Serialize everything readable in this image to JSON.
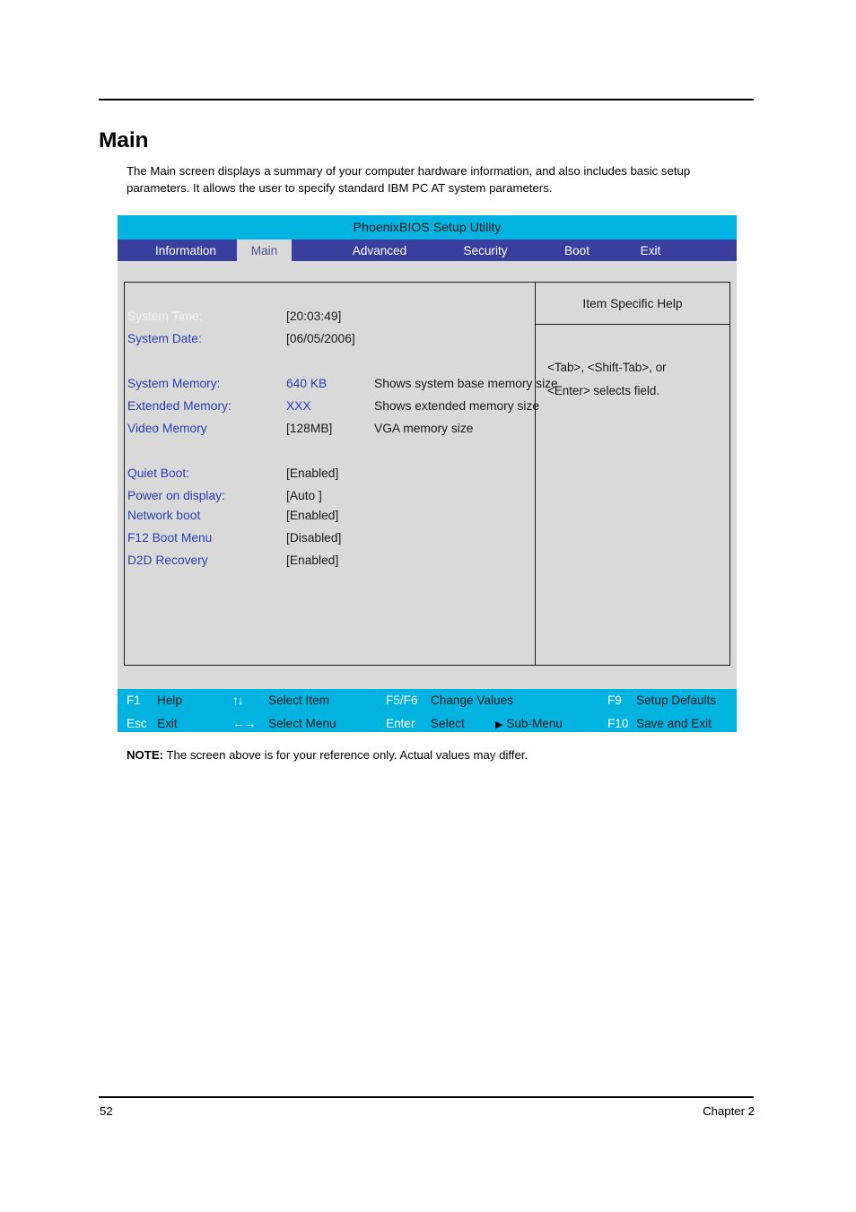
{
  "document": {
    "heading": "Main",
    "intro": "The Main screen displays a summary of your computer hardware information, and also includes basic setup parameters. It allows the user to specify standard IBM PC AT system parameters.",
    "note_label": "NOTE:",
    "note_text": " The screen above is for your reference only. Actual values may differ.",
    "page_number": "52",
    "chapter": "Chapter 2"
  },
  "bios": {
    "title": "PhoenixBIOS Setup Utility",
    "colors": {
      "title_bar": "#00b3e0",
      "tab_bar": "#3a3f9e",
      "active_tab_bg": "#d9d9d9",
      "active_tab_text": "#4a5296",
      "screen_bg": "#d9d9d9",
      "label_blue": "#2d3fb0",
      "footer_bar": "#00b3e0"
    },
    "tabs": [
      {
        "label": "Information",
        "active": false
      },
      {
        "label": "Main",
        "active": true
      },
      {
        "label": "Advanced",
        "active": false
      },
      {
        "label": "Security",
        "active": false
      },
      {
        "label": "Boot",
        "active": false
      },
      {
        "label": "Exit",
        "active": false
      }
    ],
    "settings": [
      {
        "label": "System Time:",
        "value": "[20:03:49]",
        "desc": ""
      },
      {
        "label": "System Date:",
        "value": "[06/05/2006]",
        "desc": ""
      },
      {
        "label": "System Memory:",
        "value": "640 KB",
        "desc": "Shows system base memory size"
      },
      {
        "label": "Extended Memory:",
        "value": "XXX",
        "desc": "Shows extended memory size"
      },
      {
        "label": "Video Memory",
        "value": "[128MB]",
        "desc": "VGA memory size"
      },
      {
        "label": "Quiet Boot:",
        "value": "[Enabled]",
        "desc": ""
      },
      {
        "label": "Power on display:",
        "value": "[Auto ]",
        "desc": ""
      },
      {
        "label": "Network boot",
        "value": "[Enabled]",
        "desc": ""
      },
      {
        "label": "F12 Boot Menu",
        "value": "[Disabled]",
        "desc": ""
      },
      {
        "label": "D2D Recovery",
        "value": "[Enabled]",
        "desc": ""
      }
    ],
    "help": {
      "title": "Item Specific Help",
      "line1": "<Tab>, <Shift-Tab>, or",
      "line2": "<Enter> selects field."
    },
    "footer": {
      "f1_key": "F1",
      "f1_label": "Help",
      "esc_key": "Esc",
      "esc_label": "Exit",
      "updown_sym": "↑↓",
      "updown_label": "Select Item",
      "leftright_sym": "←→",
      "leftright_label": "Select Menu",
      "f5f6_key": "F5/F6",
      "f5f6_label": "Change Values",
      "enter_key": "Enter",
      "enter_label": "Select",
      "submenu_arrow": "▶",
      "submenu_label": "Sub-Menu",
      "f9_key": "F9",
      "f9_label": "Setup Defaults",
      "f10_key": "F10",
      "f10_label": "Save and Exit"
    }
  }
}
